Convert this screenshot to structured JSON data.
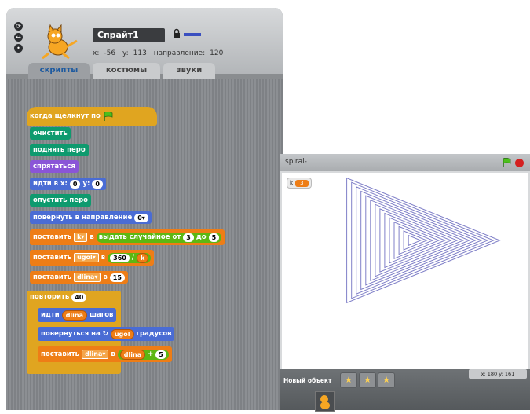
{
  "sprite": {
    "name": "Спрайт1",
    "x_label": "x:",
    "x_value": "-56",
    "y_label": "y:",
    "y_value": "113",
    "dir_label": "направление:",
    "dir_value": "120"
  },
  "tabs": [
    "скрипты",
    "костюмы",
    "звуки"
  ],
  "blocks": {
    "hat": "когда щелкнут по",
    "clear": "очистить",
    "pen_up": "поднять перо",
    "hide": "спрятаться",
    "goto_label": "идти в x:",
    "goto_x": "0",
    "goto_y_label": "y:",
    "goto_y": "0",
    "pen_down": "опустить перо",
    "point_label": "повернуть в направление",
    "point_value": "0",
    "set1_label": "поставить",
    "set1_var": "k",
    "set1_to": "в",
    "random_label": "выдать случайное от",
    "random_from": "3",
    "random_to_label": "до",
    "random_to": "5",
    "set2_label": "поставить",
    "set2_var": "ugol",
    "set2_to": "в",
    "div_a": "360",
    "div_op": "/",
    "div_b": "k",
    "set3_label": "поставить",
    "set3_var": "dlina",
    "set3_to": "в",
    "set3_value": "15",
    "repeat_label": "повторить",
    "repeat_value": "40",
    "move_label": "идти",
    "move_var": "dlina",
    "move_suffix": "шагов",
    "turn_label": "повернуться на",
    "turn_var": "ugol",
    "turn_suffix": "градусов",
    "set4_label": "поставить",
    "set4_var": "dlina",
    "set4_to": "в",
    "add_a": "dlina",
    "add_op": "+",
    "add_b": "5"
  },
  "stage": {
    "title": "spiral-",
    "monitor_label": "k",
    "monitor_value": "3",
    "new_sprite_label": "Новый объект",
    "mouse_x": "x: 180",
    "mouse_y": "y: 161"
  },
  "colors": {
    "control": "#e0a520",
    "pen": "#0e9a6e",
    "looks": "#8a55d7",
    "motion": "#4a6cd4",
    "variables": "#ee7d16",
    "operators": "#5cb712",
    "spiral": "#8080c8"
  }
}
